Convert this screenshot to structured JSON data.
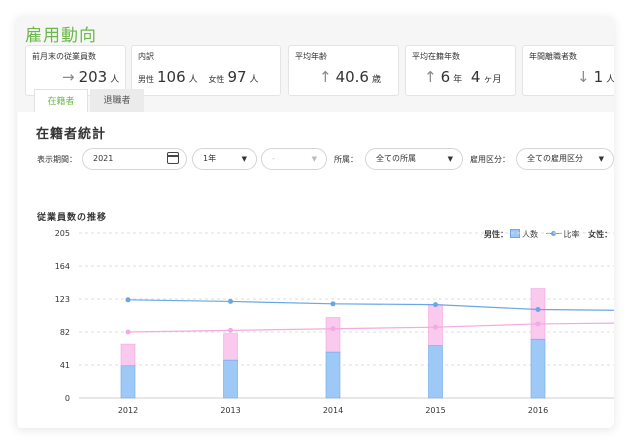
{
  "page_title": "雇用動向",
  "kpis": {
    "headcount": {
      "label": "前月末の従業員数",
      "arrow": "→",
      "value": "203",
      "unit": "人"
    },
    "breakdown": {
      "label": "内訳",
      "male_label": "男性",
      "male_value": "106",
      "male_unit": "人",
      "female_label": "女性",
      "female_value": "97",
      "female_unit": "人"
    },
    "avg_age": {
      "label": "平均年齢",
      "arrow": "↑",
      "value": "40.6",
      "unit": "歳"
    },
    "avg_tenure": {
      "label": "平均在籍年数",
      "arrow": "↑",
      "years": "6",
      "years_unit": "年",
      "months": "4",
      "months_unit": "ヶ月"
    },
    "turnover": {
      "label": "年間離職者数",
      "arrow": "↓",
      "value": "1",
      "unit": "人"
    }
  },
  "tabs": [
    {
      "label": "在籍者",
      "active": true
    },
    {
      "label": "退職者",
      "active": false
    }
  ],
  "card": {
    "title": "在籍者統計",
    "filters": {
      "period_label": "表示期間：",
      "period_value": "2021",
      "span_value": "1年",
      "sub_value": "-",
      "affiliation_label": "所属：",
      "affiliation_value": "全ての所属",
      "employment_label": "雇用区分：",
      "employment_value": "全ての雇用区分"
    },
    "section_title": "従業員数の推移",
    "legend": {
      "male_label": "男性：",
      "count_label": "人数",
      "ratio_label": "比率",
      "female_label": "女性："
    }
  },
  "colors": {
    "accent": "#6cb84a",
    "male_bar": "#9ec9f7",
    "male_line": "#6aa6e6",
    "female_bar": "#f9c9ee",
    "female_line": "#f5a8e2"
  },
  "chart_data": {
    "type": "bar",
    "categories": [
      "2012",
      "2013",
      "2014",
      "2015",
      "2016"
    ],
    "y_ticks": [
      0,
      41,
      82,
      123,
      164,
      205
    ],
    "ylim": [
      0,
      205
    ],
    "grid": true,
    "legend_position": "top-right",
    "series": [
      {
        "name": "男性 人数",
        "kind": "bar",
        "values": [
          40,
          47,
          57,
          65,
          73
        ]
      },
      {
        "name": "女性 人数",
        "kind": "bar-stacked",
        "values": [
          27,
          33,
          43,
          51,
          63
        ]
      },
      {
        "name": "男性 比率",
        "kind": "line",
        "values": [
          122,
          120,
          117,
          116,
          110
        ]
      },
      {
        "name": "女性 比率",
        "kind": "line",
        "values": [
          82,
          84,
          86,
          88,
          92
        ]
      }
    ],
    "line_trailing": {
      "男性 比率": 109,
      "女性 比率": 93
    }
  }
}
